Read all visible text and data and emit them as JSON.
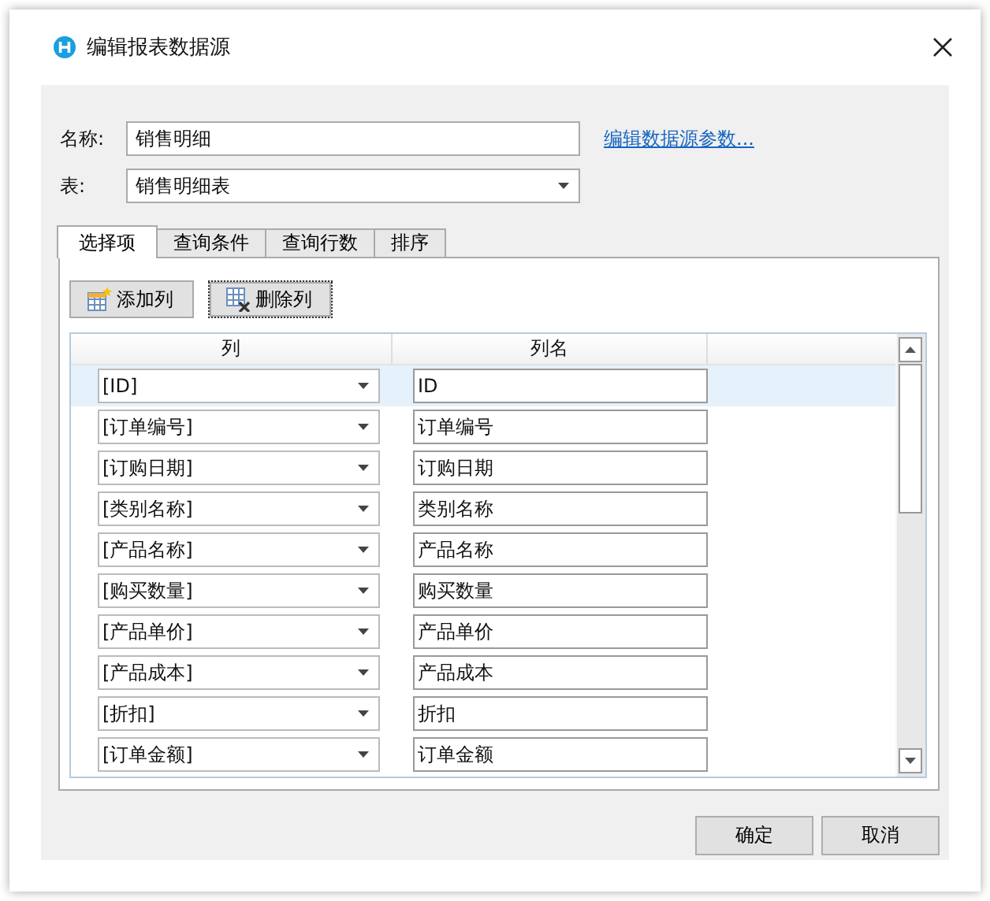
{
  "window": {
    "title": "编辑报表数据源"
  },
  "form": {
    "name_label": "名称:",
    "name_value": "销售明细",
    "link": "编辑数据源参数...",
    "table_label": "表:",
    "table_value": "销售明细表"
  },
  "tabs": [
    {
      "label": "选择项",
      "selected": true
    },
    {
      "label": "查询条件",
      "selected": false
    },
    {
      "label": "查询行数",
      "selected": false
    },
    {
      "label": "排序",
      "selected": false
    }
  ],
  "toolbar": [
    {
      "label": "添加列",
      "kind": "add",
      "focused": false
    },
    {
      "label": "删除列",
      "kind": "delete",
      "focused": true
    }
  ],
  "grid": {
    "columns": [
      "列",
      "列名"
    ],
    "rows": [
      {
        "column": "[ID]",
        "name": "ID",
        "selected": true
      },
      {
        "column": "[订单编号]",
        "name": "订单编号",
        "selected": false
      },
      {
        "column": "[订购日期]",
        "name": "订购日期",
        "selected": false
      },
      {
        "column": "[类别名称]",
        "name": "类别名称",
        "selected": false
      },
      {
        "column": "[产品名称]",
        "name": "产品名称",
        "selected": false
      },
      {
        "column": "[购买数量]",
        "name": "购买数量",
        "selected": false
      },
      {
        "column": "[产品单价]",
        "name": "产品单价",
        "selected": false
      },
      {
        "column": "[产品成本]",
        "name": "产品成本",
        "selected": false
      },
      {
        "column": "[折扣]",
        "name": "折扣",
        "selected": false
      },
      {
        "column": "[订单金额]",
        "name": "订单金额",
        "selected": false
      }
    ]
  },
  "buttons": [
    "确定",
    "取消"
  ]
}
